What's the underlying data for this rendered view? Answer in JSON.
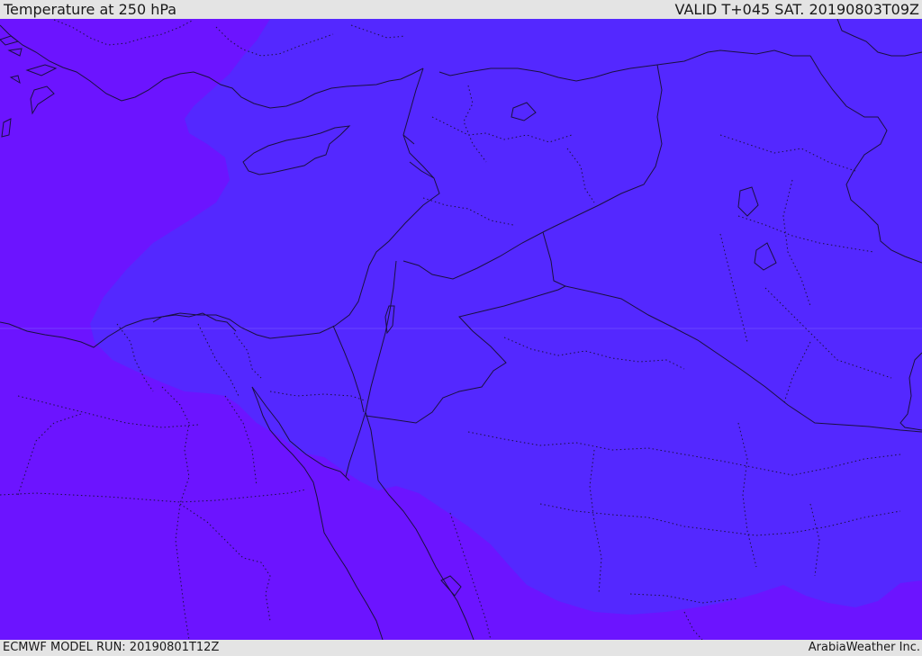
{
  "header": {
    "title": "Temperature at 250 hPa",
    "valid_time": "VALID T+045 SAT. 20190803T09Z"
  },
  "footer": {
    "model_run": "ECMWF MODEL RUN: 20190801T12Z",
    "credit": "ArabiaWeather Inc."
  },
  "map": {
    "colors": {
      "outer_band": "#6c14ff",
      "inner_band": "#5428ff",
      "outline": "#1a1040"
    }
  }
}
